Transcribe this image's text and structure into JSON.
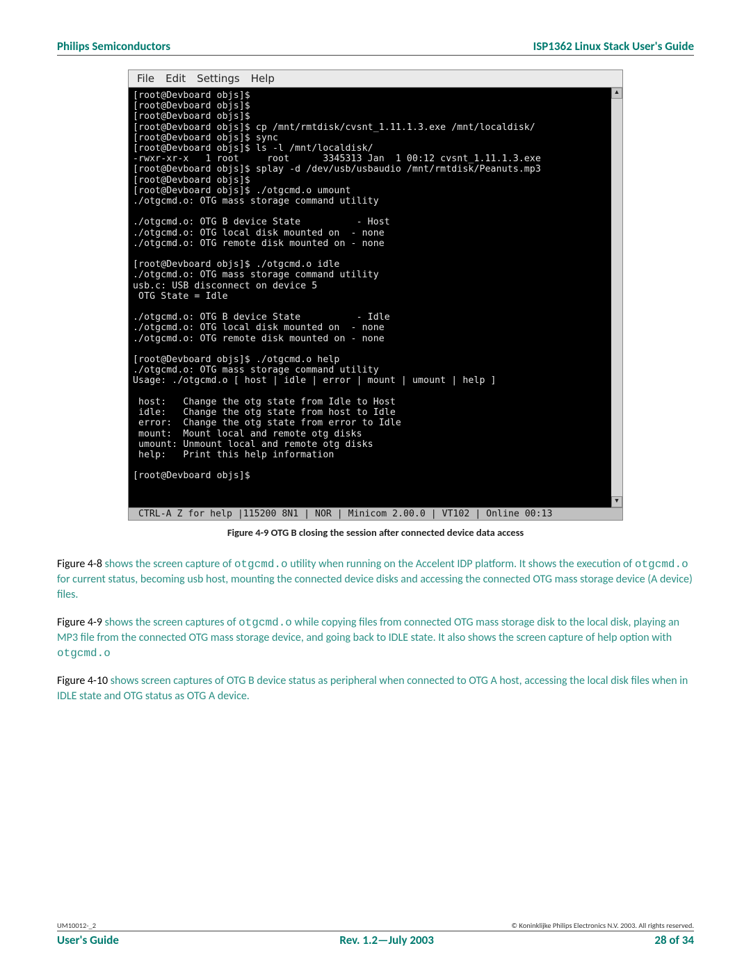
{
  "header": {
    "left": "Philips Semiconductors",
    "right": "ISP1362 Linux Stack User's Guide"
  },
  "terminal": {
    "menu": [
      "File",
      "Edit",
      "Settings",
      "Help"
    ],
    "scroll_up": "▲",
    "scroll_down": "▼",
    "content": "[root@Devboard objs]$\n[root@Devboard objs]$\n[root@Devboard objs]$\n[root@Devboard objs]$ cp /mnt/rmtdisk/cvsnt_1.11.1.3.exe /mnt/localdisk/\n[root@Devboard objs]$ sync\n[root@Devboard objs]$ ls -l /mnt/localdisk/\n-rwxr-xr-x   1 root     root      3345313 Jan  1 00:12 cvsnt_1.11.1.3.exe\n[root@Devboard objs]$ splay -d /dev/usb/usbaudio /mnt/rmtdisk/Peanuts.mp3\n[root@Devboard objs]$\n[root@Devboard objs]$ ./otgcmd.o umount\n./otgcmd.o: OTG mass storage command utility\n\n./otgcmd.o: OTG B device State          - Host\n./otgcmd.o: OTG local disk mounted on  - none\n./otgcmd.o: OTG remote disk mounted on - none\n\n[root@Devboard objs]$ ./otgcmd.o idle\n./otgcmd.o: OTG mass storage command utility\nusb.c: USB disconnect on device 5\n OTG State = Idle\n\n./otgcmd.o: OTG B device State          - Idle\n./otgcmd.o: OTG local disk mounted on  - none\n./otgcmd.o: OTG remote disk mounted on - none\n\n[root@Devboard objs]$ ./otgcmd.o help\n./otgcmd.o: OTG mass storage command utility\nUsage: ./otgcmd.o [ host | idle | error | mount | umount | help ]\n\n host:   Change the otg state from Idle to Host\n idle:   Change the otg state from host to Idle\n error:  Change the otg state from error to Idle\n mount:  Mount local and remote otg disks\n umount: Unmount local and remote otg disks\n help:   Print this help information\n\n[root@Devboard objs]$ ",
    "status": " CTRL-A Z for help |115200 8N1 | NOR | Minicom 2.00.0 | VT102 | Online 00:13"
  },
  "caption": "Figure 4-9 OTG B closing the session after connected device data access",
  "paragraphs": {
    "p1": {
      "ref": "Figure 4-8 ",
      "t1": "shows the screen capture of ",
      "c1": "otgcmd.o",
      "t2": " utility when running on the Accelent IDP platform. It shows the execution of ",
      "c2": "otgcmd.o",
      "t3": " for current status, becoming usb host, mounting the connected device disks and accessing the connected OTG mass storage device (A device) files."
    },
    "p2": {
      "ref": "Figure 4-9 ",
      "t1": "shows the screen captures of ",
      "c1": "otgcmd.o",
      "t2": " while copying files from connected OTG mass storage disk to the local disk, playing an MP3 file from the connected OTG mass storage device, and going back to IDLE state. It also shows the screen capture of help option with ",
      "c2": "otgcmd.o"
    },
    "p3": {
      "ref": "Figure 4-10 ",
      "t1": "shows screen captures of OTG B device status as peripheral when connected to OTG A host, accessing the local disk files when in IDLE state and OTG status as OTG A device."
    }
  },
  "footnote": {
    "left": "UM10012-_2",
    "right": "© Koninklijke Philips Electronics N.V. 2003. All rights reserved."
  },
  "footer": {
    "left": "User's Guide",
    "center": "Rev. 1.2—July 2003",
    "right": "28 of 34"
  }
}
